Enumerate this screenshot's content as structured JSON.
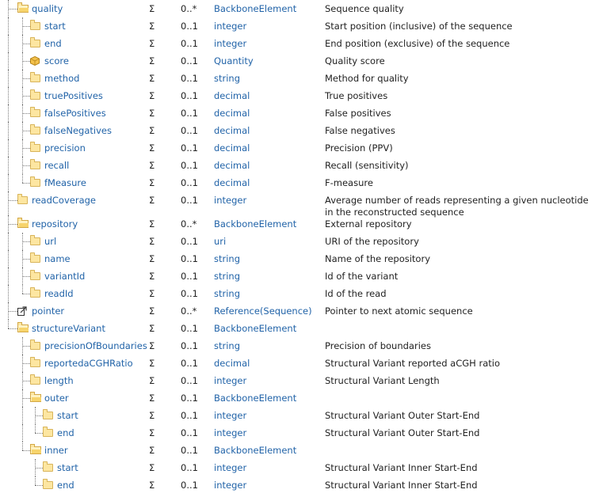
{
  "flag_symbol": "Σ",
  "colors": {
    "link": "#2163a8",
    "text": "#222222",
    "folder": "#fde6a1"
  },
  "rows": [
    {
      "name": "quality",
      "icon": "folder-open-icon",
      "depth": 0,
      "card": "0..*",
      "type": "BackboneElement",
      "desc": "Sequence quality"
    },
    {
      "name": "start",
      "icon": "folder-icon",
      "depth": 1,
      "card": "0..1",
      "type": "integer",
      "desc": "Start position (inclusive) of the sequence"
    },
    {
      "name": "end",
      "icon": "folder-icon",
      "depth": 1,
      "card": "0..1",
      "type": "integer",
      "desc": "End position (exclusive) of the sequence"
    },
    {
      "name": "score",
      "icon": "datatype-icon",
      "depth": 1,
      "card": "0..1",
      "type": "Quantity",
      "desc": "Quality score"
    },
    {
      "name": "method",
      "icon": "folder-icon",
      "depth": 1,
      "card": "0..1",
      "type": "string",
      "desc": "Method for quality"
    },
    {
      "name": "truePositives",
      "icon": "folder-icon",
      "depth": 1,
      "card": "0..1",
      "type": "decimal",
      "desc": "True positives"
    },
    {
      "name": "falsePositives",
      "icon": "folder-icon",
      "depth": 1,
      "card": "0..1",
      "type": "decimal",
      "desc": "False positives"
    },
    {
      "name": "falseNegatives",
      "icon": "folder-icon",
      "depth": 1,
      "card": "0..1",
      "type": "decimal",
      "desc": "False negatives"
    },
    {
      "name": "precision",
      "icon": "folder-icon",
      "depth": 1,
      "card": "0..1",
      "type": "decimal",
      "desc": "Precision (PPV)"
    },
    {
      "name": "recall",
      "icon": "folder-icon",
      "depth": 1,
      "card": "0..1",
      "type": "decimal",
      "desc": "Recall (sensitivity)"
    },
    {
      "name": "fMeasure",
      "icon": "folder-icon",
      "depth": 1,
      "card": "0..1",
      "type": "decimal",
      "desc": "F-measure"
    },
    {
      "name": "readCoverage",
      "icon": "folder-icon",
      "depth": 0,
      "card": "0..1",
      "type": "integer",
      "desc": "Average number of reads representing a given nucleotide in the reconstructed sequence"
    },
    {
      "name": "repository",
      "icon": "folder-open-icon",
      "depth": 0,
      "card": "0..*",
      "type": "BackboneElement",
      "desc": "External repository"
    },
    {
      "name": "url",
      "icon": "folder-icon",
      "depth": 1,
      "card": "0..1",
      "type": "uri",
      "desc": "URI of the repository"
    },
    {
      "name": "name",
      "icon": "folder-icon",
      "depth": 1,
      "card": "0..1",
      "type": "string",
      "desc": "Name of the repository"
    },
    {
      "name": "variantId",
      "icon": "folder-icon",
      "depth": 1,
      "card": "0..1",
      "type": "string",
      "desc": "Id of the variant"
    },
    {
      "name": "readId",
      "icon": "folder-icon",
      "depth": 1,
      "card": "0..1",
      "type": "string",
      "desc": "Id of the read"
    },
    {
      "name": "pointer",
      "icon": "reference-icon",
      "depth": 0,
      "card": "0..*",
      "type": "Reference(Sequence)",
      "desc": "Pointer to next atomic sequence"
    },
    {
      "name": "structureVariant",
      "icon": "folder-open-icon",
      "depth": 0,
      "card": "0..1",
      "type": "BackboneElement",
      "desc": ""
    },
    {
      "name": "precisionOfBoundaries",
      "icon": "folder-icon",
      "depth": 1,
      "card": "0..1",
      "type": "string",
      "desc": "Precision of boundaries"
    },
    {
      "name": "reportedaCGHRatio",
      "icon": "folder-icon",
      "depth": 1,
      "card": "0..1",
      "type": "decimal",
      "desc": "Structural Variant reported aCGH ratio"
    },
    {
      "name": "length",
      "icon": "folder-icon",
      "depth": 1,
      "card": "0..1",
      "type": "integer",
      "desc": "Structural Variant Length"
    },
    {
      "name": "outer",
      "icon": "folder-open-icon",
      "depth": 1,
      "card": "0..1",
      "type": "BackboneElement",
      "desc": ""
    },
    {
      "name": "start",
      "icon": "folder-icon",
      "depth": 2,
      "card": "0..1",
      "type": "integer",
      "desc": "Structural Variant Outer Start-End"
    },
    {
      "name": "end",
      "icon": "folder-icon",
      "depth": 2,
      "card": "0..1",
      "type": "integer",
      "desc": "Structural Variant Outer Start-End"
    },
    {
      "name": "inner",
      "icon": "folder-open-icon",
      "depth": 1,
      "card": "0..1",
      "type": "BackboneElement",
      "desc": ""
    },
    {
      "name": "start",
      "icon": "folder-icon",
      "depth": 2,
      "card": "0..1",
      "type": "integer",
      "desc": "Structural Variant Inner Start-End"
    },
    {
      "name": "end",
      "icon": "folder-icon",
      "depth": 2,
      "card": "0..1",
      "type": "integer",
      "desc": "Structural Variant Inner Start-End"
    }
  ]
}
